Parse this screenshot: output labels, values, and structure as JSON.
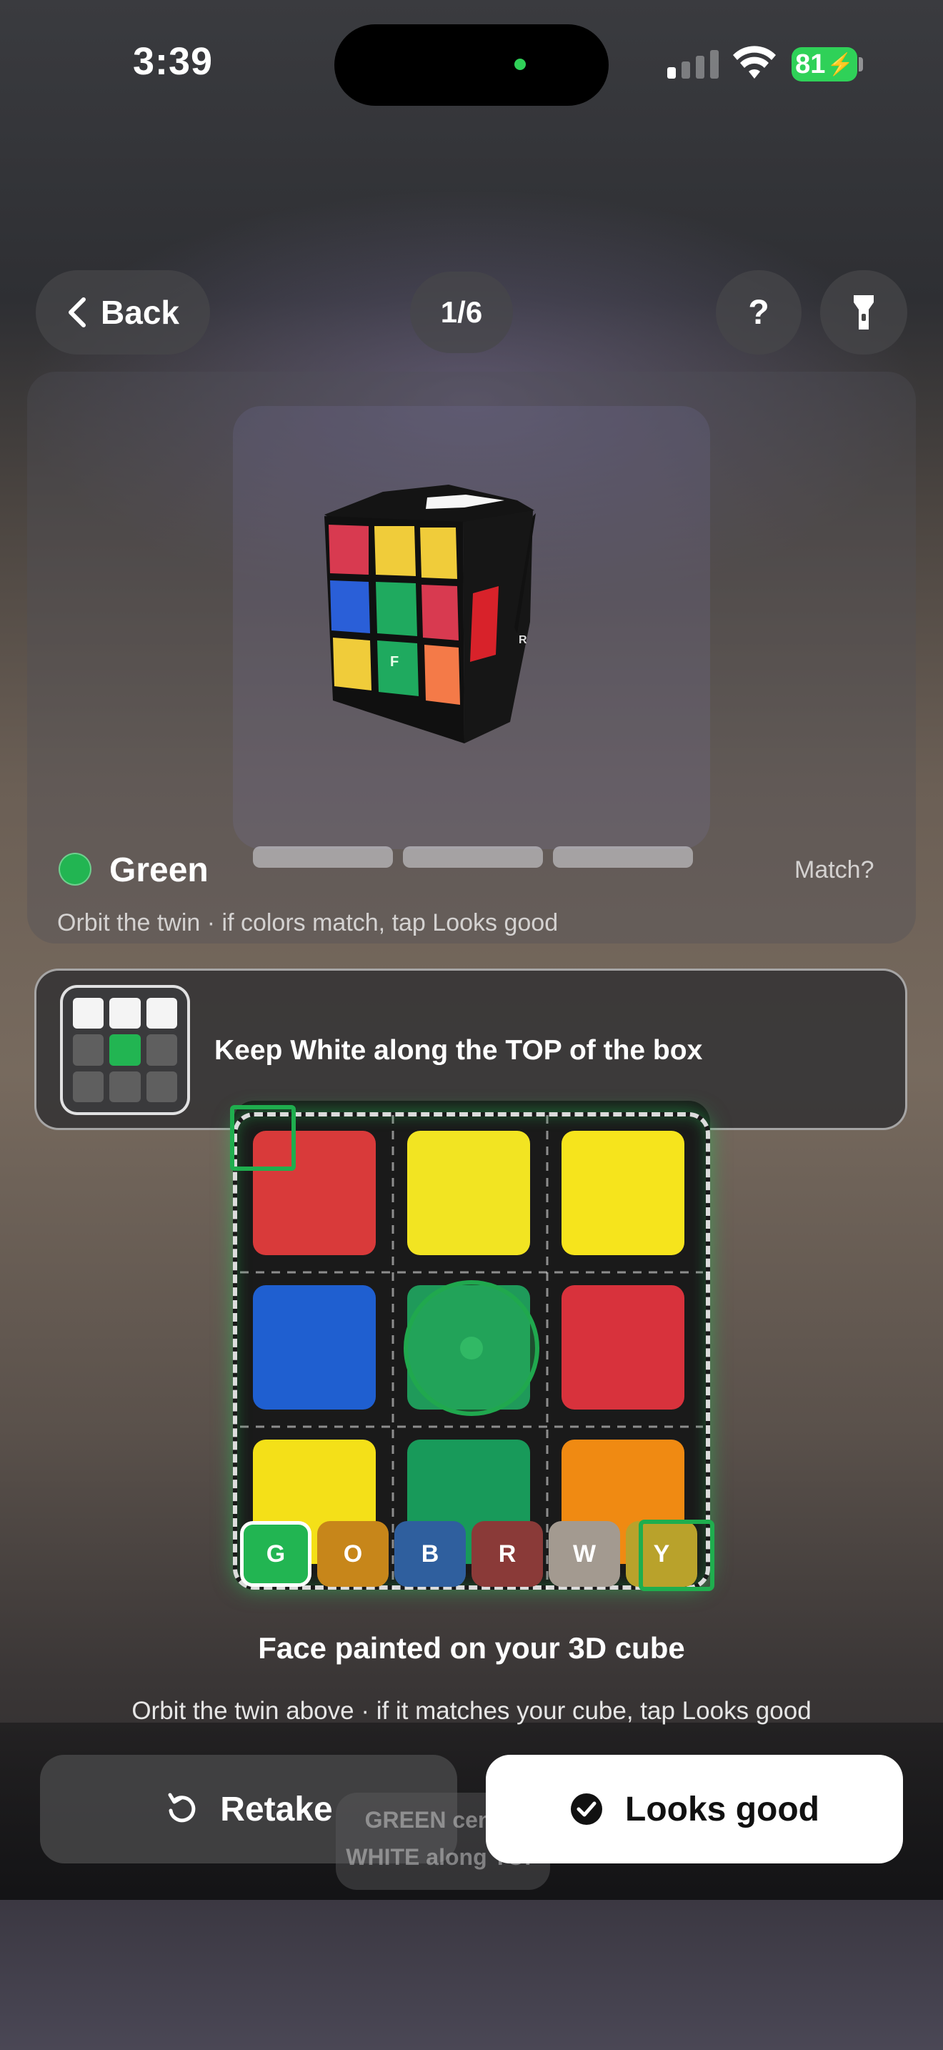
{
  "status_bar": {
    "time": "3:39",
    "battery": "81"
  },
  "top_bar": {
    "back_label": "Back",
    "counter": "1/6",
    "help_label": "?",
    "torch_icon": "flashlight-icon"
  },
  "preview": {
    "cube_face_label": "F",
    "cube_side_label": "R",
    "face_name": "Green",
    "face_color": "#22b552",
    "progress_segments": 3,
    "match_label": "Match?",
    "hint": "Orbit the twin · if colors match, tap Looks good"
  },
  "banner": {
    "text": "Keep White along the TOP of the box",
    "mini_grid": [
      "#f4f4f4",
      "#f4f4f4",
      "#f4f4f4",
      "#5f5f5f",
      "#22b552",
      "#5f5f5f",
      "#5f5f5f",
      "#5f5f5f",
      "#5f5f5f"
    ]
  },
  "scan": {
    "stickers": [
      "#d93a3a",
      "#f2e422",
      "#f6e41c",
      "#1f5fd0",
      "#1f9a5a",
      "#d8323c",
      "#f4e018",
      "#189a5a",
      "#f08a12"
    ]
  },
  "color_chips": [
    {
      "label": "G",
      "color": "#22b552",
      "selected": true
    },
    {
      "label": "O",
      "color": "#c7861a",
      "selected": false
    },
    {
      "label": "B",
      "color": "#2f5f9e",
      "selected": false
    },
    {
      "label": "R",
      "color": "#8a3a38",
      "selected": false
    },
    {
      "label": "W",
      "color": "#a39a90",
      "selected": false
    },
    {
      "label": "Y",
      "color": "#b9a22b",
      "selected": false
    }
  ],
  "caption": "Face painted on your 3D cube",
  "subcaption": "Orbit the twin above · if it matches your cube, tap Looks good",
  "actions": {
    "retake_label": "Retake",
    "looks_good_label": "Looks good"
  },
  "toast": {
    "line1": "GREEN center",
    "line2": "WHITE along TOP"
  },
  "colors": {
    "accent_green": "#22b552",
    "status_green": "#2fd158"
  }
}
